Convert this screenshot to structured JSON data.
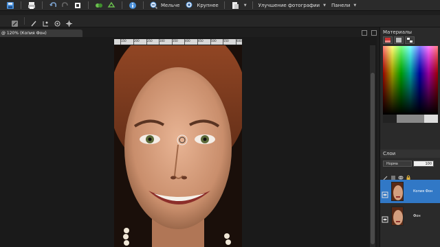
{
  "toolbar": {
    "zoom_out_label": "Мельче",
    "zoom_in_label": "Крупнее",
    "menu_enhance": "Улучшение фотографии",
    "menu_panels": "Панели"
  },
  "document": {
    "tab_title": "@ 120% (Копия Фон)"
  },
  "ruler": {
    "labels": [
      "150",
      "200",
      "250",
      "300",
      "350",
      "400",
      "450",
      "500",
      "550",
      "600"
    ]
  },
  "materials": {
    "title": "Материалы"
  },
  "layers": {
    "title": "Слои",
    "blend_mode": "Норма",
    "opacity": "100",
    "items": [
      {
        "name": "Копия Фон",
        "selected": true
      },
      {
        "name": "Фон",
        "selected": false
      }
    ]
  },
  "colors": {
    "selection": "#3178c6",
    "background": "#1e1e1e",
    "panel": "#2a2a2a"
  }
}
